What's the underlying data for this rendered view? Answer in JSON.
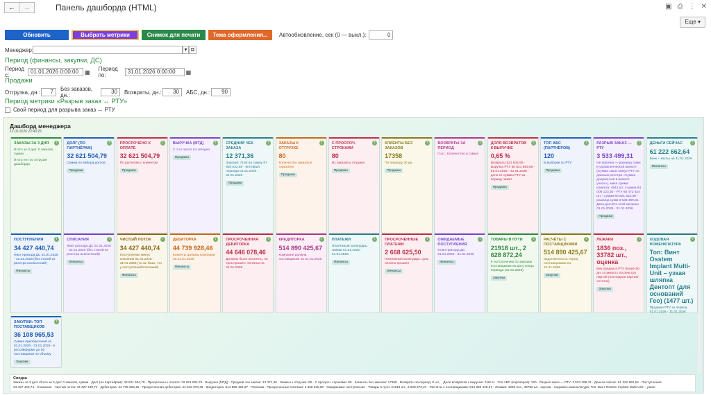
{
  "window": {
    "title": "Панель дашборда (HTML)",
    "more": "Еще"
  },
  "toolbar": {
    "refresh": "Обновить",
    "select_metrics": "Выбрать метрики",
    "snapshot": "Снимок для печати",
    "theme": "Тема оформления...",
    "autoupdate_label": "Автообновление, сек (0 — выкл.):",
    "autoupdate_value": "0"
  },
  "manager": {
    "label": "Менеджер:",
    "value": ""
  },
  "period_fin": {
    "heading": "Период (финансы, закупки, ДС)",
    "from_label": "Период с:",
    "from": "01.01.2026  0:00:00",
    "to_label": "Период по:",
    "to": "31.01.2026  0:00:00"
  },
  "sales": {
    "heading": "Продажи",
    "shipment_label": "Отгрузка, дн.:",
    "shipment": "7",
    "noorders_label": "Без заказов, дн.:",
    "noorders": "30",
    "returns_label": "Возвраты, дн.:",
    "returns": "30",
    "abc_label": "АБС, дн.:",
    "abc": "90"
  },
  "gap": {
    "heading": "Период метрики «Разрыв заказ ↔ РТУ»",
    "own_label": "Свой период для разрыва заказ ↔ РТУ"
  },
  "dashboard": {
    "title": "Дашборд менеджера",
    "date": "12.03.2026 22:40:25",
    "cards": [
      {
        "t": "Заказы за 3 дня",
        "v": "",
        "d": "Итого за 3 дня: 0 заказов, сумма",
        "d2": "Итого нет по отгрузке дашборда",
        "tag": "",
        "c": "#2e8b3e",
        "bg": "#f1f9ee"
      },
      {
        "t": "Долг (по партнёрам)",
        "v": "32 621 504,79",
        "d": "Сумма по вибора долгов",
        "tag": "Продажи",
        "c": "#1f5fb8",
        "bg": "#eef3fc"
      },
      {
        "t": "Просрочено к оплате",
        "v": "32 621 504,79",
        "d": "По расчетам с клиентом",
        "tag": "Продажи",
        "c": "#c0304a",
        "bg": "#fceef1"
      },
      {
        "t": "Выручка (МТД)",
        "v": "",
        "d": "С 1-го числа по сегодня",
        "tag": "Продажи",
        "c": "#7a46c8",
        "bg": "#f5f0fd"
      },
      {
        "t": "Средний чек заказа",
        "v": "12 371,36",
        "d": "Заказов: 7108 на сумму 87 935 622,89 - интервал периода 01.01.2026 - 31.01.2026",
        "tag": "Продажи",
        "c": "#2a7f8c",
        "bg": "#eef8f9"
      },
      {
        "t": "Заказы к отгрузке",
        "v": "80",
        "d": "Количество заказов в горизонте",
        "tag": "Продажи",
        "c": "#c86a1a",
        "bg": "#fdf3ea"
      },
      {
        "t": "С просроч. строками",
        "v": "80",
        "d": "Из заказов к отгрузке",
        "tag": "Продажи",
        "c": "#c0304a",
        "bg": "#fceef1"
      },
      {
        "t": "Клиенты без заказов",
        "v": "17358",
        "d": "По периоду 30 дн.",
        "tag": "Продажи",
        "c": "#8a7a1a",
        "bg": "#fbf8ea"
      },
      {
        "t": "Возвраты за период",
        "v": "",
        "d": "0 шт., Количество и сумма",
        "tag": "",
        "c": "#b03a8a",
        "bg": "#fbeef7"
      },
      {
        "t": "Доля возвратов к выручке",
        "v": "0,65 %",
        "d": "Возвраты 521 934,80 - выручка РТУ 80 521 893,58 - 01.01.2026 - 31.01.2026 - доля от суммы РТУ за период лимит",
        "tag": "Продажи",
        "c": "#c0304a",
        "bg": "#fceef1"
      },
      {
        "t": "Топ АБС (партнёров)",
        "v": "120",
        "d": "В выборке по РТУ",
        "tag": "Продажи",
        "c": "#1f5fb8",
        "bg": "#eef3fc"
      },
      {
        "t": "Разрыв заказ — РТУ",
        "v": "3 533 499,31",
        "d": "Не корочка — разница сумм в управленческой валюте (Сумма заказ минус РТУ по данным реестра «Сумма документов в валюте учета»), маке сумма клиента: 4543 шт. | сумма 64 006 123,30 - РТУ 60 472 624 шт. | сумма 60 521 623,99 - разница сумм 3 533 499,31. Дата досчёта этой метрики 01.01.2026 - 31.01.2026",
        "tag": "Продажи",
        "c": "#7a46c8",
        "bg": "#f5f0fd"
      },
      {
        "t": "Деньги сейчас",
        "v": "61 222 662,64",
        "d": "Банк + кассы на 31.01.2026",
        "tag": "Финансы",
        "c": "#2a7f8c",
        "bg": "#eef8f9"
      },
      {
        "t": "Поступления",
        "v": "34 427 440,74",
        "d": "Факт прихода ДС 01.01.2026 - 31.01.2026 (без статей из реестра исключений)",
        "tag": "Финансы",
        "c": "#1f5fb8",
        "bg": "#eef3fc"
      },
      {
        "t": "Списания",
        "v": "",
        "d": "Факт расхода ДС 01.01.2026 - 31.01.2026 (без статей из реестра исключений)",
        "tag": "Финансы",
        "c": "#7a46c8",
        "bg": "#f5f0fd"
      },
      {
        "t": "Чистый поток",
        "v": "34 427 440,74",
        "d": "Поступления минус списания 01.01.2026 - 31.01.2026 (то же база, что у поступлений/списаний)",
        "tag": "Финансы",
        "c": "#8a6a1a",
        "bg": "#fbf6ea"
      },
      {
        "t": "Дебиторка",
        "v": "44 739 928,46",
        "d": "Клиенты должны компании на 31.01.2026",
        "tag": "Финансы",
        "c": "#c86a1a",
        "bg": "#fdf3ea"
      },
      {
        "t": "Просроченная дебиторка",
        "v": "44 646 078,46",
        "d": "Должны были оплатить, но срок прошёл. Остатки на 31.01.2026",
        "tag": "",
        "c": "#c0304a",
        "bg": "#fceef1"
      },
      {
        "t": "Кредиторка",
        "v": "514 890 425,67",
        "d": "Компания должна поставщикам на 31.01.2026",
        "tag": "",
        "c": "#b03a8a",
        "bg": "#fbeef7"
      },
      {
        "t": "Платежи",
        "v": "",
        "d": "Платёжный календарь: заявки 01.01.2026 - 31.01.2026",
        "tag": "Финансы",
        "c": "#2a7f8c",
        "bg": "#eef8f9"
      },
      {
        "t": "Просроченные платежи",
        "v": "2 668 625,50",
        "d": "Платёжный календарь: срок оплаты прошёл",
        "tag": "Финансы",
        "c": "#c0304a",
        "bg": "#fceef1"
      },
      {
        "t": "Ожидаемые поступления",
        "v": "",
        "d": "План прихода ДС 01.01.2026 - 31.01.2026",
        "tag": "Финансы",
        "c": "#7a46c8",
        "bg": "#f5f0fd"
      },
      {
        "t": "Товары в пути",
        "v": "21918 шт., 2 628 872,24",
        "d": "К поступлению по заказам поставщикам на дату конца периода (31.01.2026)",
        "tag": "Закупки",
        "c": "#2e8b3e",
        "bg": "#f1f9ee"
      },
      {
        "t": "Расчёты с поставщиками",
        "v": "514 890 425,67",
        "d": "Задолженность перед поставщиками на 31.01.2026",
        "tag": "Закупки",
        "c": "#8a7a1a",
        "bg": "#fbf8ea"
      },
      {
        "t": "Лежаки",
        "v": "1836 поз., 33782 шт., оценка",
        "d": "Без продаж в РТУ более 90 дн. стоимость по реестру партий (последние партии/остаток)",
        "tag": "Закупки",
        "c": "#c0304a",
        "bg": "#fceef1"
      },
      {
        "t": "Ходовая номенклатура",
        "v": "Топ: Винт Osstem Implant Multi-Unit – узкая шляпка Дентопт (для оснований Гео) (1477 шт.)",
        "d": "Продажи РТУ за период 01.01.2026 - 31.01.2026",
        "tag": "Закупки",
        "c": "#2a7f8c",
        "bg": "#eef8f9"
      },
      {
        "t": "Закупки: топ поставщиков",
        "v": "36 108 965,53",
        "d": "Сумма приобретений за 01.01.2026 - 31.01.2026 - в российформе до 50 поставщиков по объему",
        "tag": "Закупки",
        "c": "#1f5fb8",
        "bg": "#eef3fc"
      }
    ],
    "summary_title": "Сводка",
    "summary_line1": "Заказы за 3 дня: Итого за 3 дня: 0 заказов, сумма · Долг (по партнёрам): 32 621 504,79 · Просрочено к оплате: 32 621 504,79 · Выручка (МТД) · Средний чек заказа: 12 371,36 · Заказы к отгрузке: 80 · С просроч. строками: 80 · Клиенты без заказов: 17358 · Возвраты за период: 0 шт., · Доля возвратов к выручке: 0,65 % · Топ АБС (партнёров): 120 · Разрыв заказ — РТУ: 3 533 499,31 · Деньги сейчас: 61 222 662,64 · Поступления:",
    "summary_line2": "34 427 440,74 · Списания · Чистый поток: 34 427 440,74 · Дебиторка: 44 739 928,46 · Просроченная дебиторка: 44 646 078,46 · Кредиторка: 514 890 425,67 · Платежи · Просроченные платежи: 2 668 625,50 · Ожидаемые поступления · Товары в пути: 21918 шт., 2 628 872,24 · Расчёты с поставщиками: 514 890 425,67 · Лежаки: 1836 поз., 33782 шт., оценка · Ходовая номенклатура: Топ: Винт Osstem Implant Multi-Unit – узкая"
  }
}
